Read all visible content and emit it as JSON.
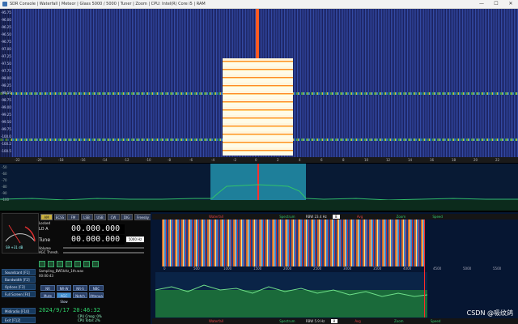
{
  "app": {
    "title": "SDR Console | Waterfall | Meteor | Glass 5000 / 5000 | Tuner | Zoom | CPU: Intel(R) Core i5 | RAM",
    "window_controls": [
      "—",
      "☐",
      "✕"
    ]
  },
  "waterfall": {
    "scale_labels": [
      "-95.75",
      "-96.00",
      "-96.25",
      "-96.50",
      "-96.75",
      "-97.00",
      "-97.25",
      "-97.50",
      "-97.75",
      "-98.00",
      "-98.25",
      "-98.50",
      "-98.75",
      "-99.00",
      "-99.25",
      "-99.50",
      "-99.75",
      "-100.0",
      "-100.2",
      "-100.5"
    ],
    "freq_ticks": [
      "-22",
      "-20",
      "-18",
      "-16",
      "-14",
      "-12",
      "-10",
      "-8",
      "-6",
      "-4",
      "-2",
      "0",
      "2",
      "4",
      "6",
      "8",
      "10",
      "12",
      "14",
      "16",
      "18",
      "20",
      "22"
    ]
  },
  "spectrum": {
    "db_labels": [
      "-50",
      "-60",
      "-70",
      "-80",
      "-90",
      "-100"
    ]
  },
  "panel": {
    "smeter_label": "S9 +31 dB",
    "mode_buttons": [
      "AM",
      "ECSS",
      "FM",
      "LSB",
      "USB",
      "CW",
      "DIG",
      "Freesky"
    ],
    "active_mode": "AM",
    "locked_label": "Locked",
    "lo_label": "LO A",
    "tune_label": "Tune",
    "lo_freq": "00.000.000",
    "tune_freq": "00.000.000",
    "bandwidth": "5000 Hz",
    "volume_label": "Volume",
    "agc_label": "AGC Thresh.",
    "recording_file": "Sampling_BW5kHz_1th.wav",
    "recording_time": "00:00:43",
    "side_buttons": [
      "Soundcard [F1]",
      "Bandwidth [F2]",
      "Options [F3]",
      "Full Screen [F4]",
      "Midiradio [F10]",
      "Exit [F12]"
    ],
    "dsp_buttons": [
      "NR",
      "NR-W",
      "NR-S",
      "NBC",
      "Mute",
      "AGC Slow",
      "Notch",
      "Attenua"
    ],
    "active_dsp": "AGC Slow",
    "datetime": "2024/9/17 20:46:32",
    "cpu_lines": [
      "CPU Cmsg: 0%",
      "CPU Total: 2%"
    ]
  },
  "zoom_panel": {
    "top_bar": {
      "waterfall": "Waterfall",
      "spectrum": "Spectrum",
      "rbw": "RBW 23.4 Hz",
      "rbw_value": "8",
      "avg": "Avg",
      "zoom": "Zoom",
      "speed": "Speed"
    },
    "bottom_bar": {
      "waterfall": "Waterfall",
      "spectrum": "Spectrum",
      "rbw": "RBW 5.9 Hz",
      "rbw_value": "8",
      "avg": "Avg",
      "zoom": "Zoom",
      "speed": "Speed"
    },
    "axis_ticks": [
      "0",
      "500",
      "1000",
      "1500",
      "2000",
      "2500",
      "3000",
      "3500",
      "4000",
      "4500",
      "5000",
      "5500"
    ]
  },
  "watermark": "CSDN @吸纹鸽"
}
